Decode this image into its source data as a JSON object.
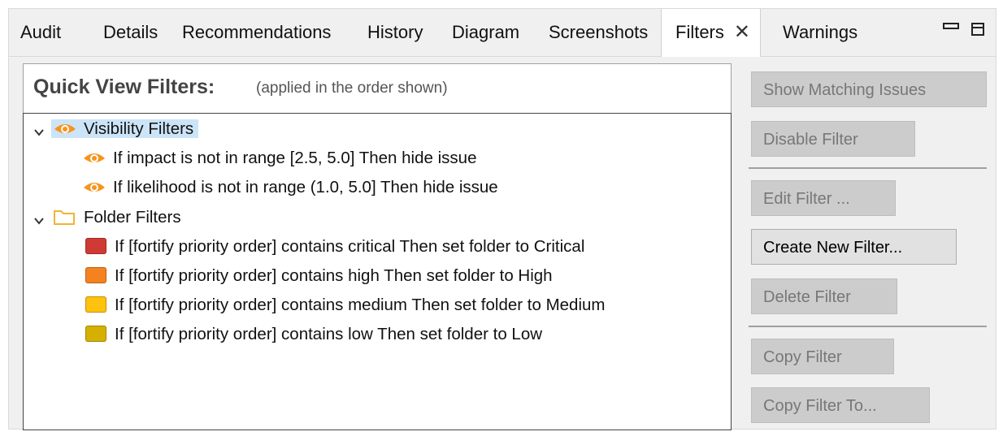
{
  "tabs": [
    {
      "label": "Audit"
    },
    {
      "label": "Details"
    },
    {
      "label": "Recommendations"
    },
    {
      "label": "History"
    },
    {
      "label": "Diagram"
    },
    {
      "label": "Screenshots"
    },
    {
      "label": "Filters",
      "active": true
    },
    {
      "label": "Warnings"
    }
  ],
  "header": {
    "title": "Quick View Filters:",
    "subtitle": "(applied in the order shown)"
  },
  "tree": {
    "visibility_group": "Visibility Filters",
    "visibility_items": [
      "If impact is not in range [2.5, 5.0] Then hide issue",
      "If likelihood is not in range (1.0, 5.0] Then hide issue"
    ],
    "folder_group": "Folder Filters",
    "folder_items": [
      {
        "label": "If [fortify priority order] contains critical Then set folder to Critical",
        "color": "#d03a34"
      },
      {
        "label": "If [fortify priority order] contains high Then set folder to High",
        "color": "#f58220"
      },
      {
        "label": "If [fortify priority order] contains medium Then set folder to Medium",
        "color": "#ffc20e"
      },
      {
        "label": "If [fortify priority order] contains low Then set folder to Low",
        "color": "#d6b000"
      }
    ]
  },
  "buttons": {
    "show_matching": "Show Matching Issues",
    "disable": "Disable Filter",
    "edit": "Edit Filter ...",
    "create": "Create New Filter...",
    "delete": "Delete Filter",
    "copy": "Copy Filter",
    "copy_to": "Copy Filter To..."
  },
  "colors": {
    "eye": "#f7941d",
    "folder": "#f5b335",
    "selection": "#cce4f7"
  },
  "icons": {
    "close": "close-icon",
    "minimize": "minimize-icon",
    "maximize": "maximize-icon",
    "eye": "eye-icon",
    "folder": "folder-icon",
    "chevron": "chevron-down-icon"
  }
}
